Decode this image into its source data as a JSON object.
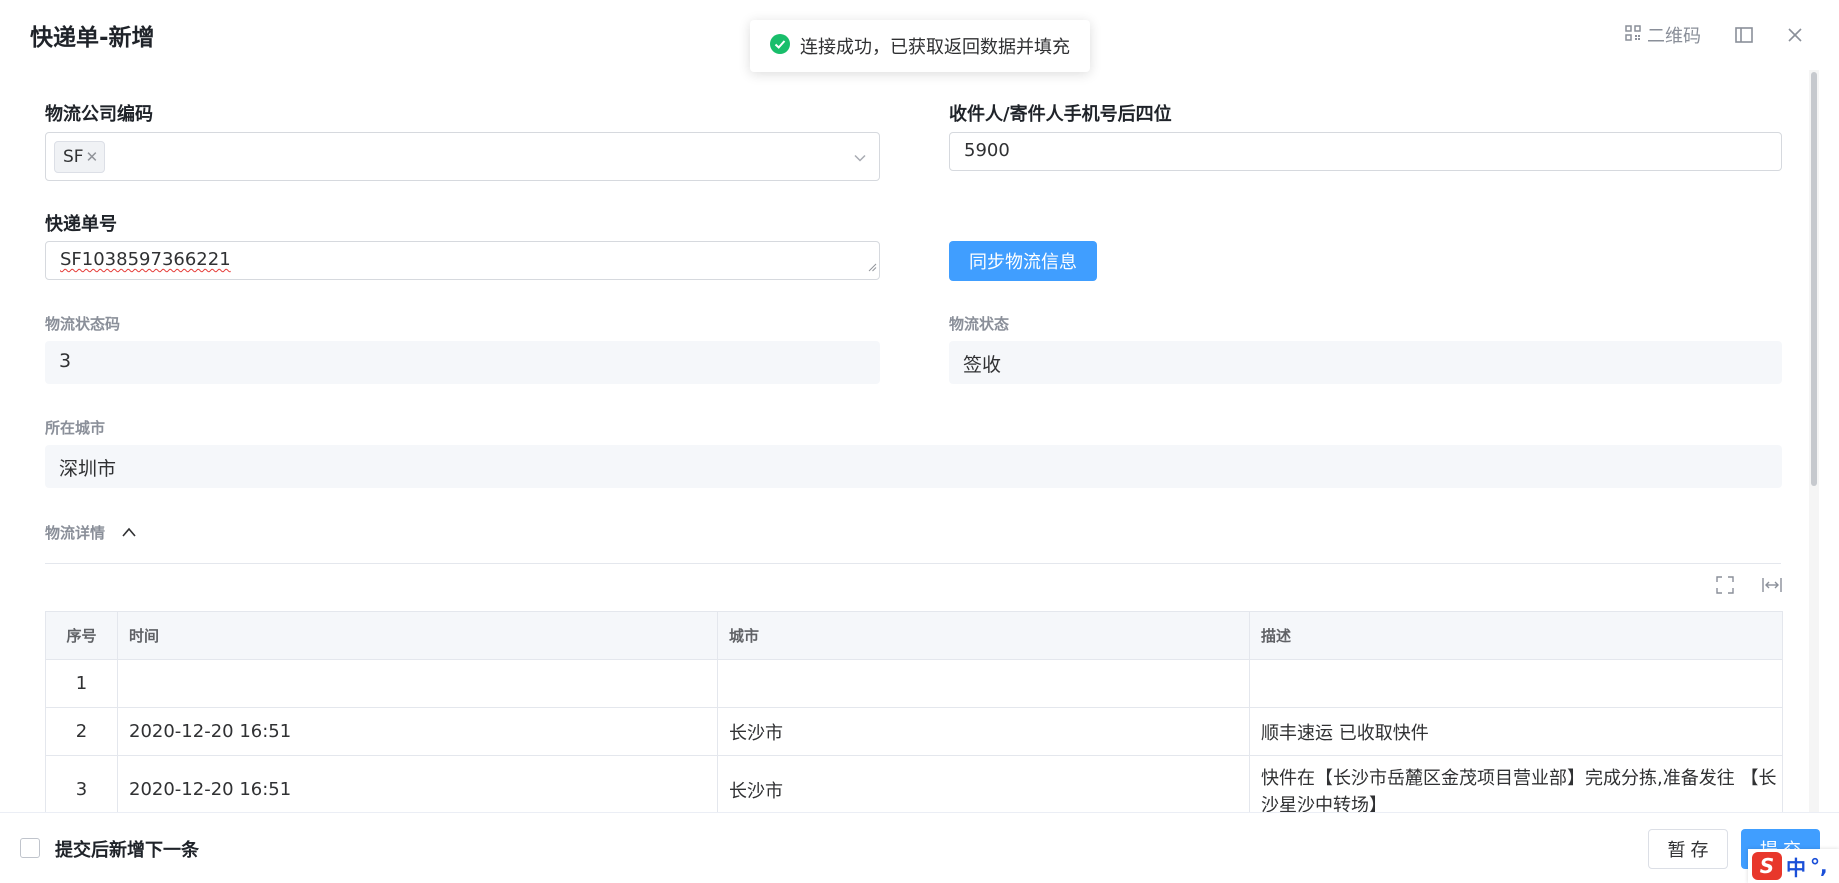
{
  "dialog": {
    "title": "快递单-新增",
    "qr_label": "二维码"
  },
  "toast": {
    "message": "连接成功，已获取返回数据并填充"
  },
  "form": {
    "company_code": {
      "label": "物流公司编码",
      "tag": "SF"
    },
    "phone_last4": {
      "label": "收件人/寄件人手机号后四位",
      "value": "5900"
    },
    "tracking_no": {
      "label": "快递单号",
      "value": "SF1038597366221"
    },
    "sync_button": "同步物流信息",
    "status_code": {
      "label": "物流状态码",
      "value": "3"
    },
    "status": {
      "label": "物流状态",
      "value": "签收"
    },
    "city": {
      "label": "所在城市",
      "value": "深圳市"
    },
    "details_label": "物流详情"
  },
  "table": {
    "columns": [
      "序号",
      "时间",
      "城市",
      "描述"
    ],
    "rows": [
      {
        "no": "1",
        "time": "",
        "city": "",
        "desc": ""
      },
      {
        "no": "2",
        "time": "2020-12-20 16:51",
        "city": "长沙市",
        "desc": "顺丰速运 已收取快件"
      },
      {
        "no": "3",
        "time": "2020-12-20 16:51",
        "city": "长沙市",
        "desc": "快件在【长沙市岳麓区金茂项目营业部】完成分拣,准备发往 【长沙星沙中转场】"
      }
    ]
  },
  "footer": {
    "checkbox_label": "提交后新增下一条",
    "save_draft": "暂 存",
    "submit": "提 交"
  },
  "ime": {
    "mode": "中",
    "punct": "°,"
  },
  "colors": {
    "primary": "#409eff",
    "success": "#19be6b"
  }
}
